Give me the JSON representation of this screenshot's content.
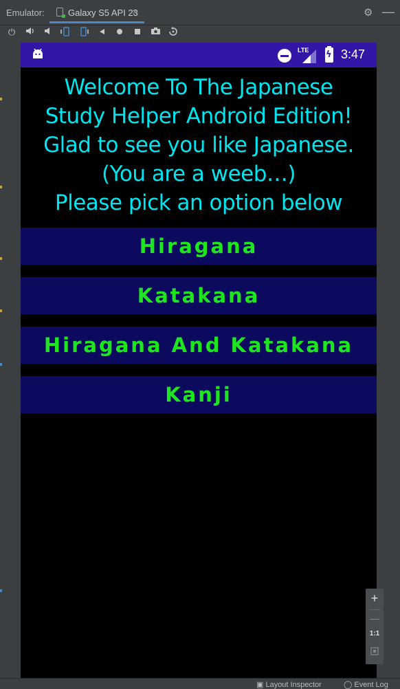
{
  "ide": {
    "emulator_label": "Emulator:",
    "device_tab": "Galaxy S5 API 23",
    "close_glyph": "×",
    "settings_icon": "gear-icon",
    "minimize_glyph": "—",
    "toolbar_icons": [
      "power-icon",
      "volume-up-icon",
      "volume-down-icon",
      "rotate-left-icon",
      "rotate-right-icon",
      "back-icon",
      "home-icon",
      "overview-icon",
      "camera-icon",
      "replay-icon"
    ],
    "bottom_bar": {
      "layout_inspector": "Layout Inspector",
      "event_log": "Event Log"
    },
    "zoom": {
      "plus": "+",
      "ratio": "1:1",
      "minus": "—"
    }
  },
  "device": {
    "status_bar": {
      "network": "LTE",
      "time": "3:47",
      "bar_color": "#3316a6"
    },
    "welcome_lines": [
      "Welcome To The Japanese",
      "Study Helper Android Edition!",
      "Glad to see you like Japanese.",
      "(You are a weeb…)",
      "Please pick an option below"
    ],
    "options": [
      {
        "label": "Hiragana"
      },
      {
        "label": "Katakana"
      },
      {
        "label": "Hiragana And Katakana"
      },
      {
        "label": "Kanji"
      }
    ],
    "colors": {
      "welcome_text": "#00e5f0",
      "button_bg": "#0b0a5e",
      "button_text": "#1ee61e",
      "screen_bg": "#000000"
    }
  }
}
